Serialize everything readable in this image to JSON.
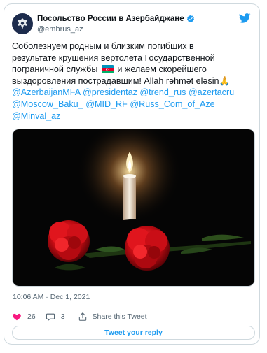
{
  "tweet": {
    "display_name": "Посольство России в Азербайджане",
    "handle": "@embrus_az",
    "text_lines": [
      [
        {
          "t": "Соболезнуем родным и близким погибших в"
        }
      ],
      [
        {
          "t": "результате крушения вертолета Государственной"
        }
      ],
      [
        {
          "t": "пограничной службы "
        },
        {
          "flag": "azerbaijan"
        },
        {
          "t": " и желаем скорейшего"
        }
      ],
      [
        {
          "t": "выздоровления пострадавшим! Allah rəhmət eləsin🙏"
        }
      ],
      [
        {
          "m": "@AzerbaijanMFA"
        },
        {
          "t": " "
        },
        {
          "m": "@presidentaz"
        },
        {
          "t": " "
        },
        {
          "m": "@trend_rus"
        },
        {
          "t": " "
        },
        {
          "m": "@azertacru"
        }
      ],
      [
        {
          "m": "@Moscow_Baku_"
        },
        {
          "t": " "
        },
        {
          "m": "@MID_RF"
        },
        {
          "t": " "
        },
        {
          "m": "@Russ_Com_of_Aze"
        }
      ],
      [
        {
          "m": "@Minval_az"
        }
      ]
    ],
    "timestamp": "10:06 AM · Dec 1, 2021"
  },
  "actions": {
    "likes": "26",
    "replies": "3",
    "share_label": "Share this Tweet"
  },
  "reply_button_label": "Tweet your reply",
  "colors": {
    "accent": "#1d9bf0",
    "like": "#f91880",
    "text": "#0f1419",
    "muted": "#536471"
  },
  "icons": [
    "verified-badge-icon",
    "twitter-bird-icon",
    "heart-icon",
    "info-icon",
    "speech-bubble-icon",
    "share-icon"
  ]
}
